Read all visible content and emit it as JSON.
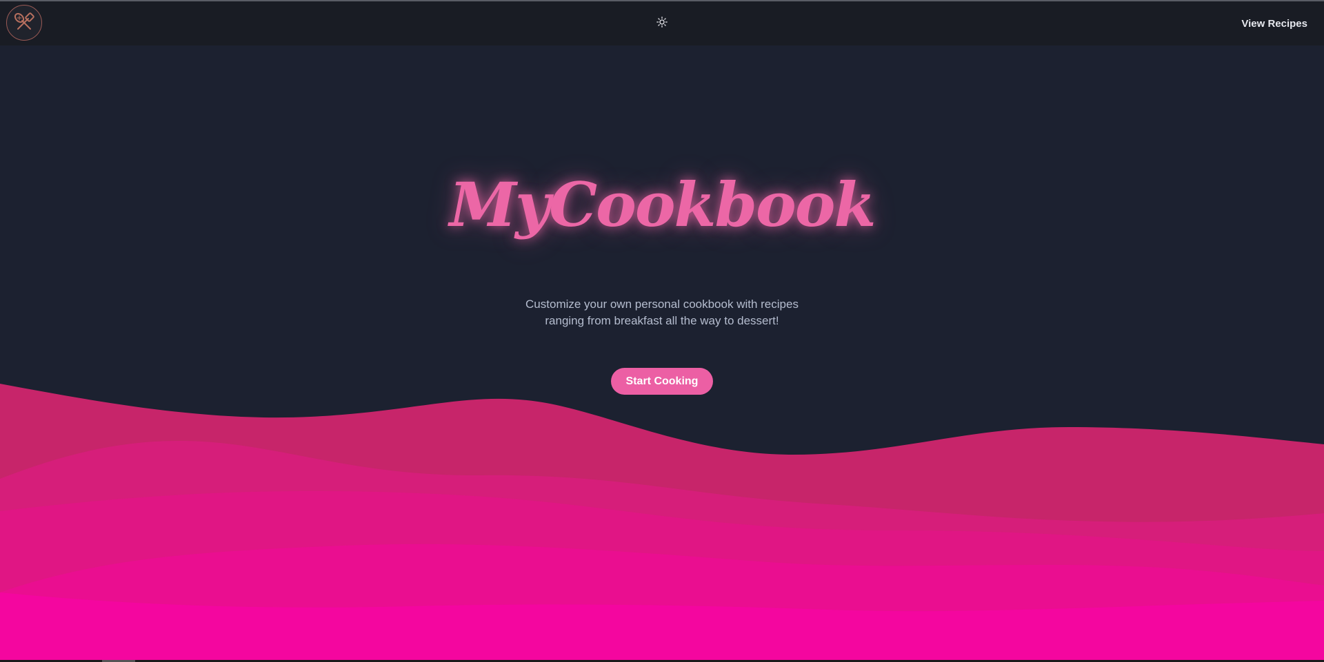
{
  "navbar": {
    "logo_icon": "whisk-and-spatula-icon",
    "theme_icon": "sun-icon",
    "link_label": "View Recipes"
  },
  "hero": {
    "title": "MyCookbook",
    "subtitle_line1": "Customize your own personal cookbook with recipes",
    "subtitle_line2": "ranging from breakfast all the way to dessert!",
    "cta_label": "Start Cooking"
  },
  "colors": {
    "background": "#1c2130",
    "navbar": "#191c24",
    "accent_pink": "#ec67a6",
    "wave_1": "#c7256a",
    "wave_2": "#d61e7a",
    "wave_3": "#e01684",
    "wave_4": "#ea0e90",
    "wave_5": "#f4069f"
  }
}
